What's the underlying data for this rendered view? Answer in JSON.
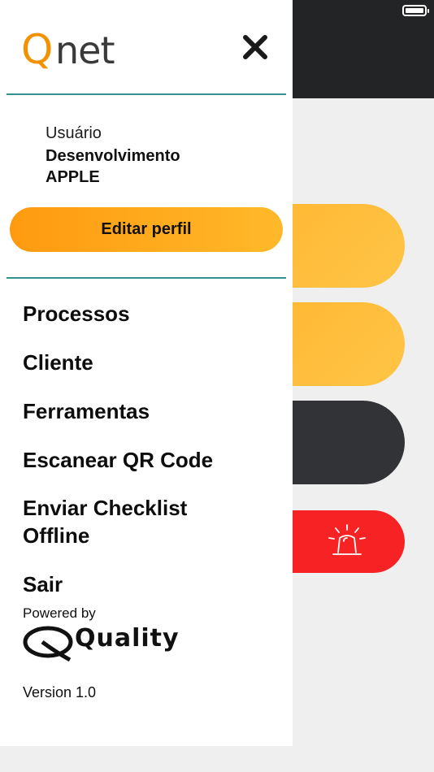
{
  "app": {
    "logo_text": "Qnet",
    "logo_color": "#f39200",
    "accent_color": "#ffb630",
    "rule_color": "#33928f"
  },
  "drawer": {
    "user_label": "Usuário",
    "user_name_line1": "Desenvolvimento",
    "user_name_line2": "APPLE",
    "edit_profile": "Editar perfil",
    "menu": [
      {
        "label": "Processos"
      },
      {
        "label": "Cliente"
      },
      {
        "label": "Ferramentas"
      },
      {
        "label": "Escanear QR Code"
      },
      {
        "label": "Enviar Checklist"
      },
      {
        "label": "Offline"
      },
      {
        "label": "Sair"
      }
    ],
    "powered_by": "Powered by",
    "brand": "Quality",
    "version": "Version 1.0"
  },
  "icons": {
    "close": "close-icon",
    "battery": "battery-icon",
    "alarm": "siren-icon"
  }
}
